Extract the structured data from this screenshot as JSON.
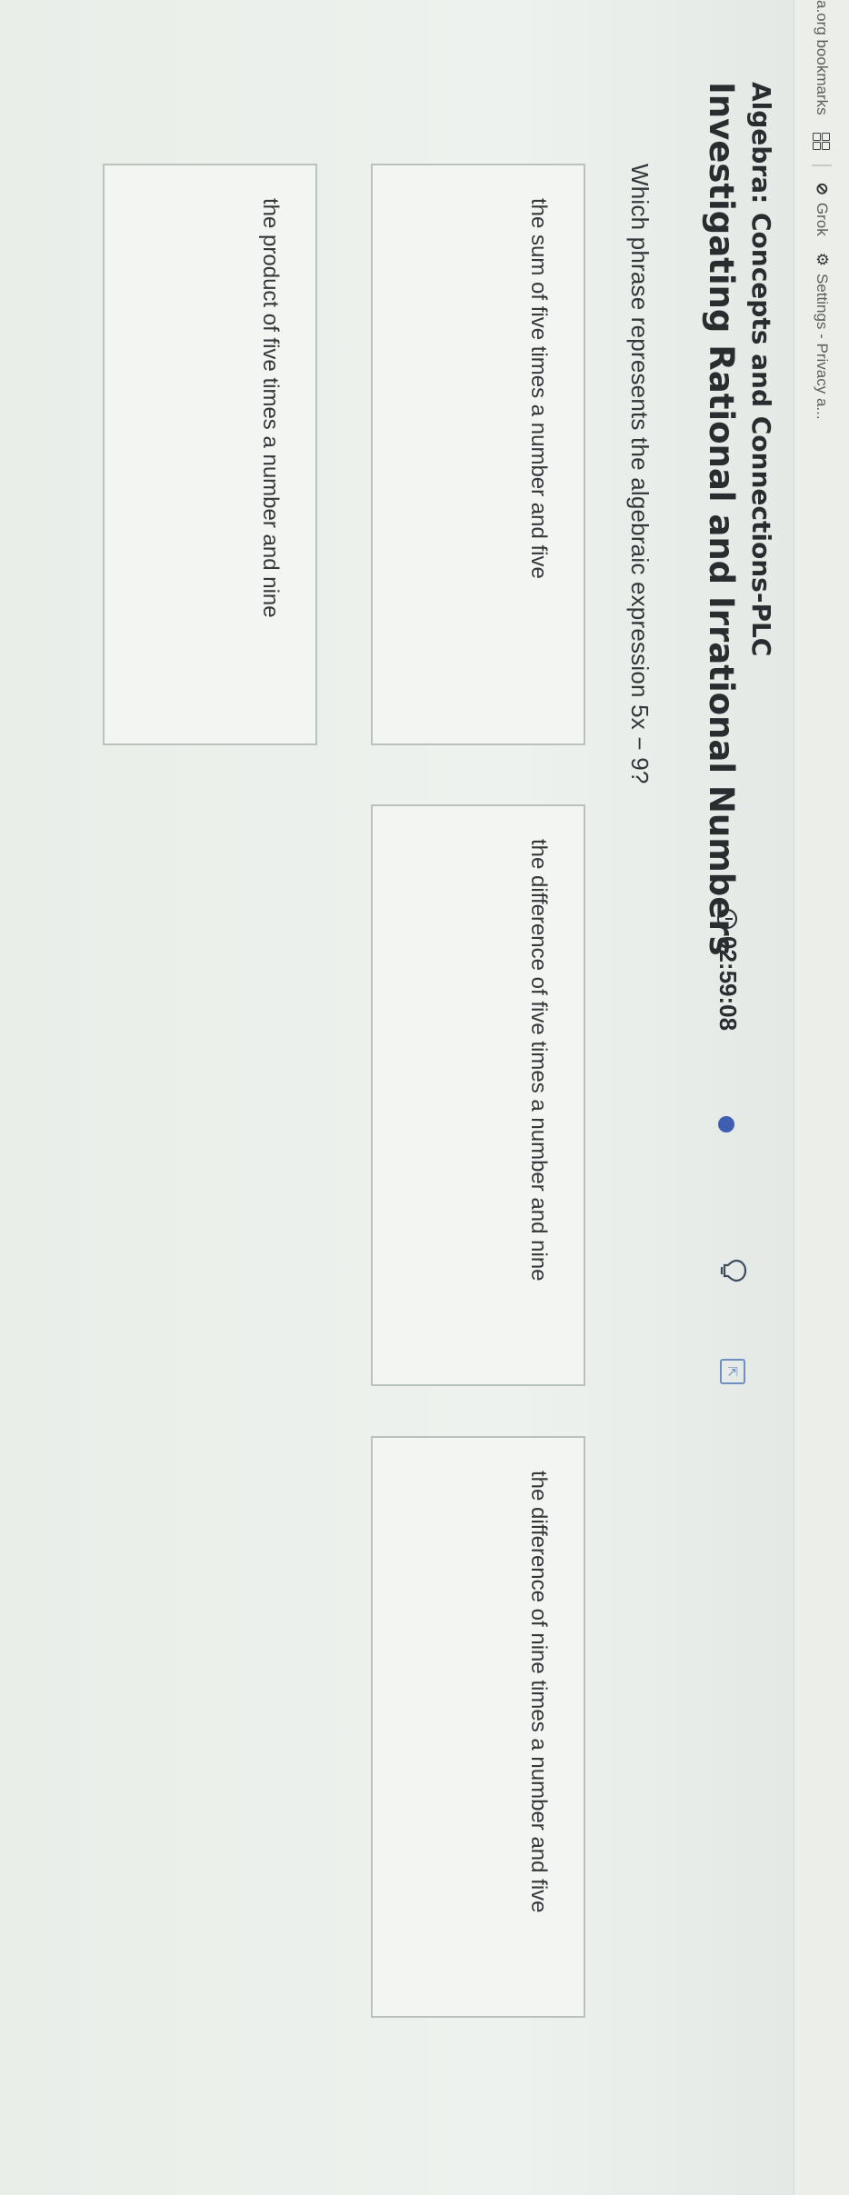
{
  "bookmarks": {
    "items": [
      {
        "label": "a.org bookmarks"
      },
      {
        "label": "Grok"
      },
      {
        "label": "Settings - Privacy a..."
      }
    ]
  },
  "header": {
    "course": "Algebra: Concepts and Connections-PLC",
    "lesson": "Investigating Rational and Irrational Numbers",
    "timer": "02:59:08"
  },
  "question": {
    "prompt": "Which phrase represents the algebraic expression 5x − 9?"
  },
  "options": [
    {
      "text": "the sum of five times a number and five"
    },
    {
      "text": "the difference of five times a number and nine"
    },
    {
      "text": "the difference of nine times a number and five"
    },
    {
      "text": "the product of five times a number and nine"
    }
  ],
  "colors": {
    "accent": "#3e5fb0",
    "background": "#e9eee9"
  }
}
